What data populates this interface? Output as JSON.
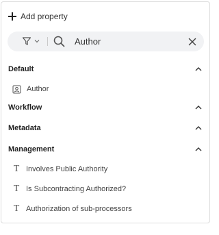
{
  "toolbar": {
    "add_property_label": "Add property"
  },
  "search": {
    "value": "Author",
    "placeholder": ""
  },
  "sections": {
    "default": {
      "title": "Default",
      "items": [
        {
          "label": "Author",
          "icon": "person-badge-icon"
        }
      ]
    },
    "workflow": {
      "title": "Workflow"
    },
    "metadata": {
      "title": "Metadata"
    },
    "management": {
      "title": "Management",
      "items": [
        {
          "label": "Involves Public Authority",
          "icon": "text-type-icon"
        },
        {
          "label": "Is Subcontracting Authorized?",
          "icon": "text-type-icon"
        },
        {
          "label": "Authorization of sub-processors",
          "icon": "text-type-icon"
        }
      ]
    }
  },
  "colors": {
    "search_background": "#f1f2f4",
    "panel_border": "#dcdcdc",
    "text": "#2b2b2b"
  }
}
